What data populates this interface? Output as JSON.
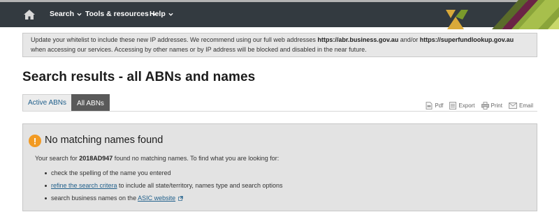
{
  "nav": {
    "home_icon": "home-icon",
    "items": [
      {
        "label": "Search"
      },
      {
        "label": "Tools & resources"
      },
      {
        "label": "Help"
      }
    ]
  },
  "notice": {
    "text_before": "Update your whitelist to include these new IP addresses. We recommend using our full web addresses ",
    "link_1": "https://abr.business.gov.au",
    "text_mid": " and/or ",
    "link_2": "https://superfundlookup.gov.au",
    "text_after": " when accessing our services. Accessing by other names or by IP address will be blocked and disabled in the near future."
  },
  "page": {
    "title": "Search results - all ABNs and names"
  },
  "tabs": [
    {
      "label": "Active ABNs",
      "active": false
    },
    {
      "label": "All ABNs",
      "active": true
    }
  ],
  "actions": [
    {
      "label": "Pdf",
      "icon": "pdf-icon"
    },
    {
      "label": "Export",
      "icon": "export-icon"
    },
    {
      "label": "Print",
      "icon": "print-icon"
    },
    {
      "label": "Email",
      "icon": "email-icon"
    }
  ],
  "result": {
    "heading": "No matching names found",
    "summary_before": "Your search for ",
    "search_term": "2018AD947",
    "summary_after": " found no matching names. To find what you are looking for:",
    "tips": {
      "tip1": "check the spelling of the name you entered",
      "tip2_link": "refine the search critera",
      "tip2_rest": " to include all state/territory, names type and search options",
      "tip3_before": "search business names on the ",
      "tip3_link": "ASIC website"
    }
  },
  "colors": {
    "navbar": "#333a40",
    "brand_gold": "#d9a93a",
    "brand_green": "#7a9a2b",
    "brand_purple": "#6b2346",
    "warning": "#f29a22",
    "link": "#1f5f8b"
  }
}
